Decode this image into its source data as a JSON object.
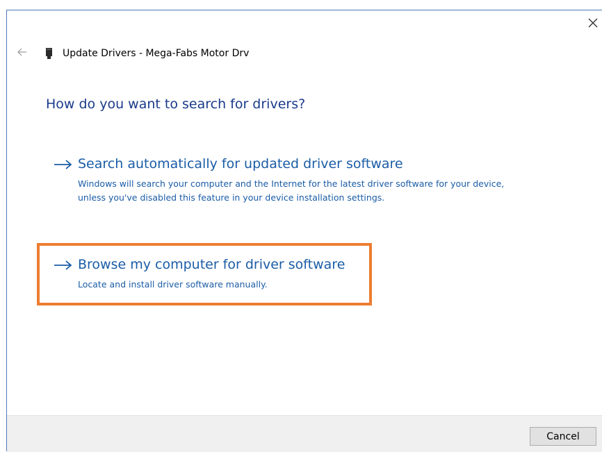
{
  "window": {
    "title": "Update Drivers - Mega-Fabs Motor Drv",
    "back_icon": "back-arrow-icon",
    "close_icon": "close-icon",
    "device_icon": "device-icon"
  },
  "main": {
    "heading": "How do you want to search for drivers?",
    "options": [
      {
        "title": "Search automatically for updated driver software",
        "description": "Windows will search your computer and the Internet for the latest driver software for your device, unless you've disabled this feature in your device installation settings.",
        "icon": "arrow-right-icon"
      },
      {
        "title": "Browse my computer for driver software",
        "description": "Locate and install driver software manually.",
        "icon": "arrow-right-icon",
        "highlighted": true
      }
    ]
  },
  "footer": {
    "cancel_label": "Cancel"
  },
  "colors": {
    "heading": "#1a3a8a",
    "link": "#1a5ca6",
    "highlight": "#ed7d31",
    "footer_bg": "#f0f0f0",
    "window_border": "#4a78b8"
  }
}
